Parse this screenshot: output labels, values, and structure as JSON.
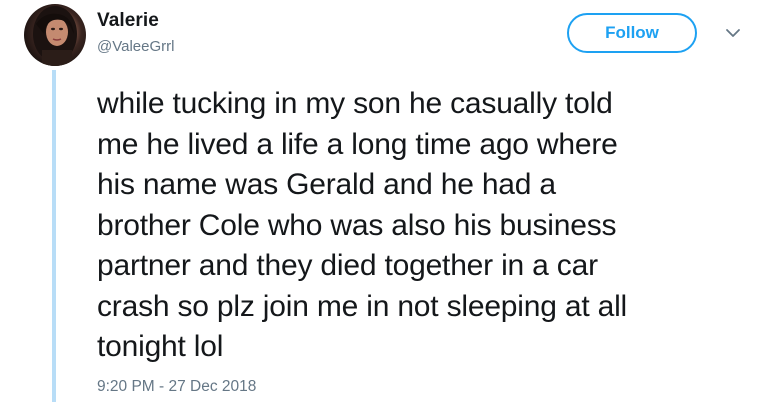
{
  "user": {
    "display_name": "Valerie",
    "handle": "@ValeeGrrl"
  },
  "actions": {
    "follow_label": "Follow",
    "more_icon": "chevron-down-icon"
  },
  "tweet": {
    "text": "while tucking in my son he casually told\nme he lived a life a long time ago where\nhis name was Gerald and he had a\nbrother Cole who was also his business\npartner and they died together in a car\ncrash so plz join me in not sleeping at all\ntonight lol",
    "timestamp": "9:20 PM - 27 Dec 2018"
  },
  "colors": {
    "accent": "#1da1f2",
    "thread_line": "#b8ddf7",
    "secondary_text": "#657786",
    "primary_text": "#14171a"
  }
}
